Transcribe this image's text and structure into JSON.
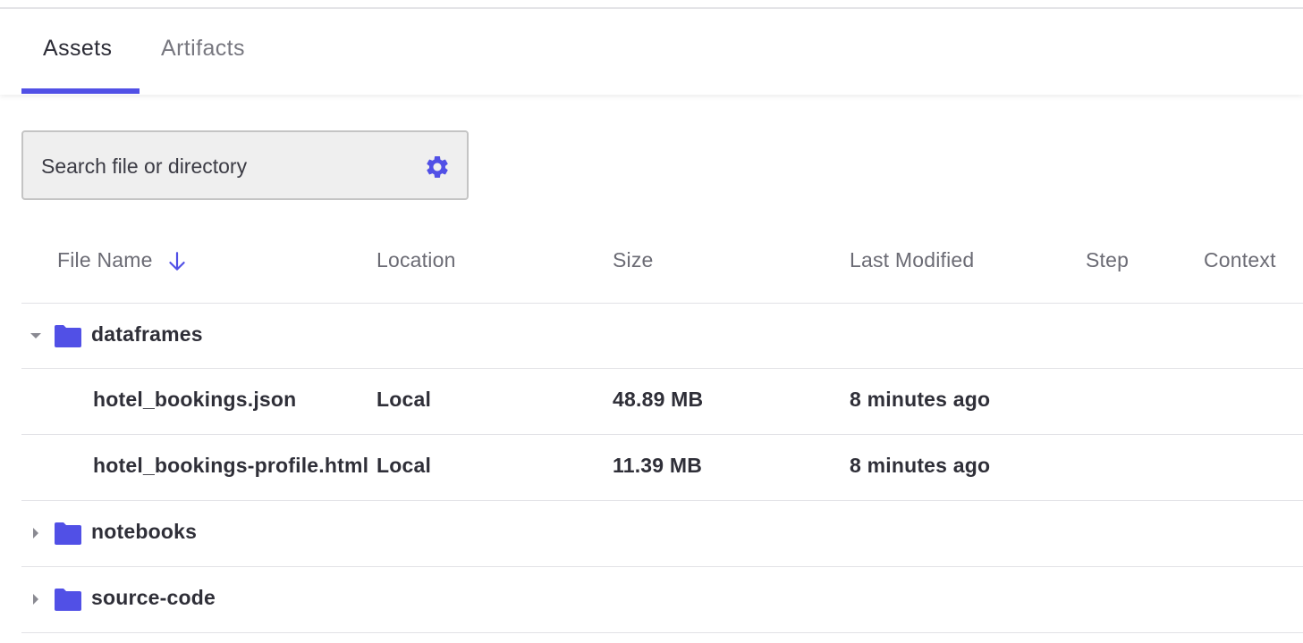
{
  "tabs": [
    {
      "label": "Assets",
      "active": true
    },
    {
      "label": "Artifacts",
      "active": false
    }
  ],
  "search": {
    "placeholder": "Search file or directory",
    "icon": "gear-icon"
  },
  "columns": {
    "name": "File Name",
    "location": "Location",
    "size": "Size",
    "modified": "Last Modified",
    "step": "Step",
    "context": "Context"
  },
  "sort_icon": "arrow-down-icon",
  "colors": {
    "accent": "#5150e6",
    "folder": "#5150e6"
  },
  "folders": [
    {
      "name": "dataframes",
      "expanded": true,
      "files": [
        {
          "name": "hotel_bookings.json",
          "location": "Local",
          "size": "48.89 MB",
          "modified": "8 minutes ago"
        },
        {
          "name": "hotel_bookings-profile.html",
          "location": "Local",
          "size": "11.39 MB",
          "modified": "8 minutes ago"
        }
      ]
    },
    {
      "name": "notebooks",
      "expanded": false
    },
    {
      "name": "source-code",
      "expanded": false
    }
  ]
}
